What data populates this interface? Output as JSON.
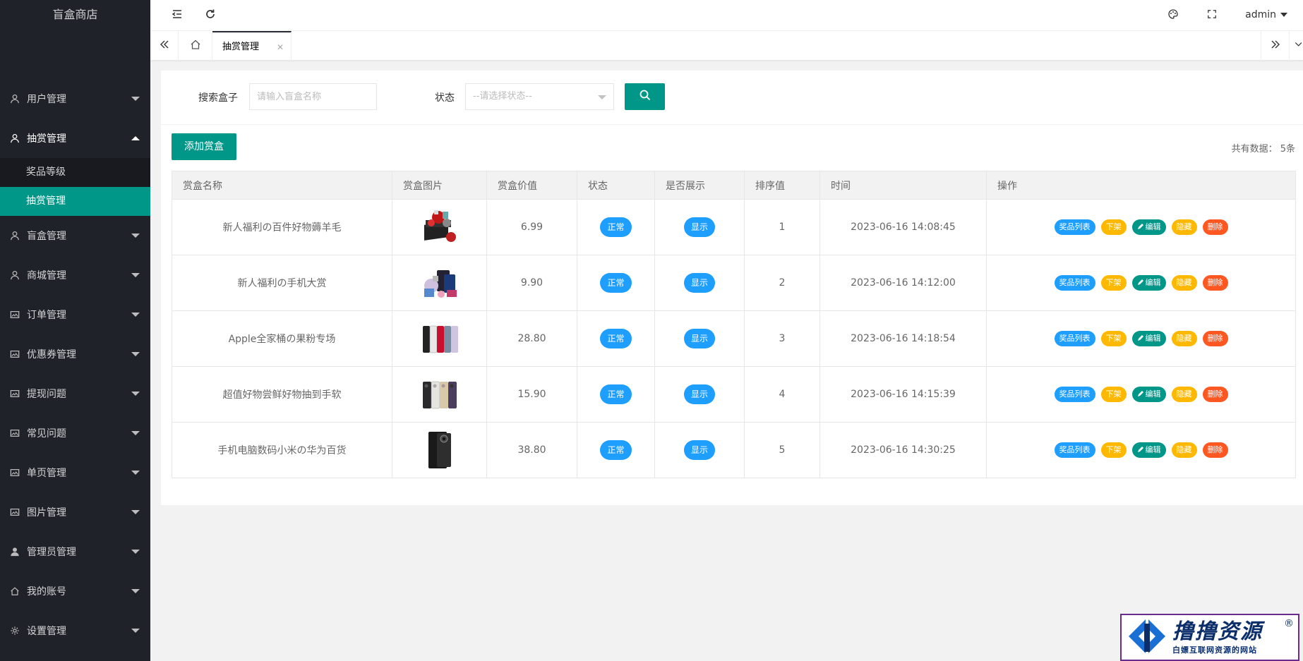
{
  "app": {
    "title": "盲盒商店"
  },
  "sidebar": {
    "items": [
      {
        "label": "用户管理",
        "icon": "user-icon"
      },
      {
        "label": "抽赏管理",
        "icon": "user-icon",
        "open": true,
        "children": [
          {
            "label": "奖品等级"
          },
          {
            "label": "抽赏管理",
            "active": true
          }
        ]
      },
      {
        "label": "盲盒管理",
        "icon": "user-icon"
      },
      {
        "label": "商城管理",
        "icon": "user-icon"
      },
      {
        "label": "订单管理",
        "icon": "image-icon"
      },
      {
        "label": "优惠券管理",
        "icon": "image-icon"
      },
      {
        "label": "提现问题",
        "icon": "image-icon"
      },
      {
        "label": "常见问题",
        "icon": "image-icon"
      },
      {
        "label": "单页管理",
        "icon": "image-icon"
      },
      {
        "label": "图片管理",
        "icon": "image-icon"
      },
      {
        "label": "管理员管理",
        "icon": "person-icon"
      },
      {
        "label": "我的账号",
        "icon": "home-icon"
      },
      {
        "label": "设置管理",
        "icon": "gear-icon"
      }
    ]
  },
  "header": {
    "user": "admin"
  },
  "tabs": [
    {
      "label": "抽赏管理",
      "active": true
    }
  ],
  "search": {
    "box_label": "搜索盒子",
    "box_placeholder": "请输入盲盒名称",
    "status_label": "状态",
    "status_placeholder": "--请选择状态--"
  },
  "toolbar": {
    "add_label": "添加赏盒",
    "total_text": "共有数据：  5条"
  },
  "table": {
    "columns": [
      "赏盒名称",
      "赏盒图片",
      "赏盒价值",
      "状态",
      "是否展示",
      "排序值",
      "时间",
      "操作"
    ],
    "rows": [
      {
        "name": "新人福利の百件好物薅羊毛",
        "price": "6.99",
        "status": "正常",
        "show": "显示",
        "sort": "1",
        "time": "2023-06-16 14:08:45",
        "img": "gift-box"
      },
      {
        "name": "新人福利の手机大赏",
        "price": "9.90",
        "status": "正常",
        "show": "显示",
        "sort": "2",
        "time": "2023-06-16 14:12:00",
        "img": "gadgets"
      },
      {
        "name": "Apple全家桶の果粉专场",
        "price": "28.80",
        "status": "正常",
        "show": "显示",
        "sort": "3",
        "time": "2023-06-16 14:18:54",
        "img": "iphones"
      },
      {
        "name": "超值好物尝鲜好物抽到手软",
        "price": "15.90",
        "status": "正常",
        "show": "显示",
        "sort": "4",
        "time": "2023-06-16 14:15:39",
        "img": "iphones-dark"
      },
      {
        "name": "手机电脑数码小米の华为百货",
        "price": "38.80",
        "status": "正常",
        "show": "显示",
        "sort": "5",
        "time": "2023-06-16 14:30:25",
        "img": "fold-phone"
      }
    ],
    "ops": {
      "prizes": "奖品列表",
      "offline": "下架",
      "edit": "编辑",
      "hide": "隐藏",
      "delete": "删除"
    }
  },
  "watermark": {
    "title": "撸撸资源",
    "subtitle": "白嫖互联网资源的网站",
    "reg": "®"
  }
}
